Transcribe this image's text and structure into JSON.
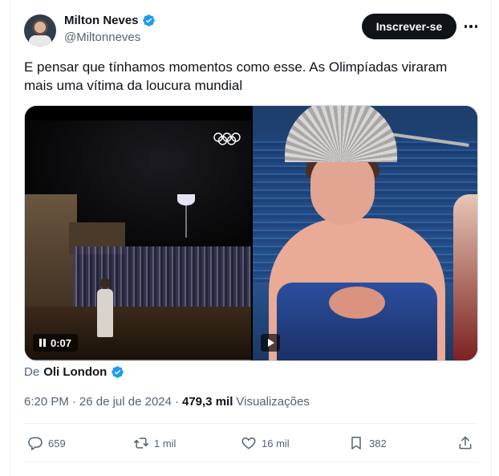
{
  "author": {
    "name": "Milton Neves",
    "handle": "@Miltonneves"
  },
  "header": {
    "subscribe_label": "Inscrever-se"
  },
  "tweet": {
    "text": "E pensar que tínhamos momentos como esse. As Olimpíadas viraram mais uma vítima da loucura mundial"
  },
  "media": {
    "video_time": "0:07",
    "video_progress": 0.05
  },
  "source": {
    "prefix": "De",
    "name": "Oli London"
  },
  "meta": {
    "time": "6:20 PM",
    "separator": "·",
    "date": "26 de jul de 2024",
    "views_count": "479,3 mil",
    "views_label": "Visualizações"
  },
  "actions": {
    "replies": "659",
    "reposts": "1 mil",
    "likes": "16 mil",
    "bookmarks": "382"
  },
  "colors": {
    "verified": "#1d9bf0",
    "text_primary": "#0f1419",
    "text_secondary": "#536471",
    "divider": "#eff3f4"
  }
}
